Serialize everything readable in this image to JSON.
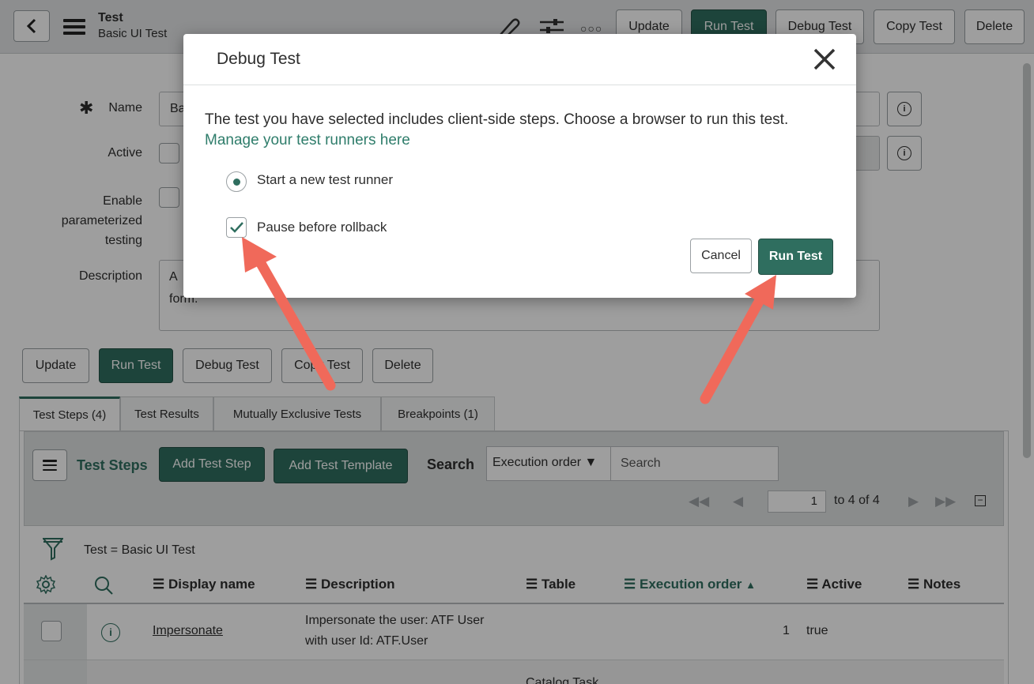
{
  "header": {
    "title": "Test",
    "subtitle": "Basic UI Test",
    "buttons": {
      "update": "Update",
      "run_test": "Run Test",
      "debug_test": "Debug Test",
      "copy_test": "Copy Test",
      "delete": "Delete"
    }
  },
  "form": {
    "name_label": "Name",
    "name_value_visible": "Ba",
    "active_label": "Active",
    "param_label_1": "Enable",
    "param_label_2": "parameterized",
    "param_label_3": "testing",
    "description_label": "Description",
    "description_visible_1": "A",
    "description_visible_2": "form."
  },
  "form_buttons": {
    "update": "Update",
    "run_test": "Run Test",
    "debug_test": "Debug Test",
    "copy_test": "Copy Test",
    "delete": "Delete"
  },
  "tabs": [
    {
      "label": "Test Steps (4)"
    },
    {
      "label": "Test Results"
    },
    {
      "label": "Mutually Exclusive Tests"
    },
    {
      "label": "Breakpoints (1)"
    }
  ],
  "list": {
    "title": "Test Steps",
    "add_step": "Add Test Step",
    "add_template": "Add Test Template",
    "search_label": "Search",
    "search_field": "Execution order ▼",
    "search_placeholder": "Search",
    "pager_value": "1",
    "pager_text": "to 4 of 4",
    "filter_text": "Test = Basic UI Test",
    "columns": {
      "display_name": "Display name",
      "description": "Description",
      "table": "Table",
      "execution_order": "Execution order",
      "active": "Active",
      "notes": "Notes"
    },
    "rows": [
      {
        "display_name": "Impersonate",
        "description_1": "Impersonate the user: ATF User",
        "description_2": "with user Id: ATF.User",
        "execution_order": "1",
        "active": "true"
      }
    ],
    "partial_row_table": "Catalog Task"
  },
  "modal": {
    "title": "Debug Test",
    "message": "The test you have selected includes client-side steps. Choose a browser to run this test.",
    "link": "Manage your test runners here",
    "option_new_runner": "Start a new test runner",
    "option_pause": "Pause before rollback",
    "cancel": "Cancel",
    "run_test": "Run Test"
  },
  "colors": {
    "primary": "#2f6e5f",
    "link": "#2f7d6b",
    "annotation_arrow": "#f0695a"
  }
}
